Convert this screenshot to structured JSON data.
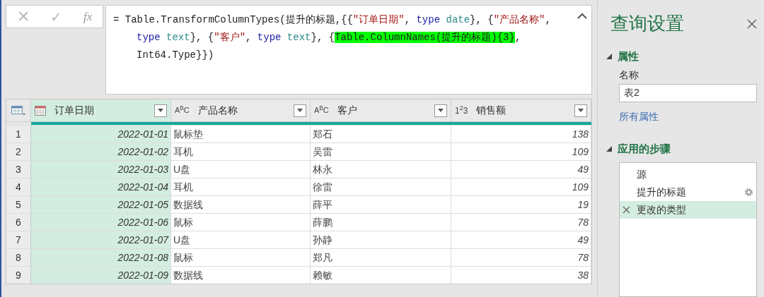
{
  "formula_bar": {
    "cancel": "✕",
    "confirm": "✓",
    "fx": "fx",
    "lines": [
      [
        {
          "kind": "plain",
          "text": "= Table.TransformColumnTypes(提升的标题,{{"
        },
        {
          "kind": "string",
          "text": "\"订单日期\""
        },
        {
          "kind": "plain",
          "text": ", "
        },
        {
          "kind": "keyword",
          "text": "type"
        },
        {
          "kind": "type",
          "text": " date"
        },
        {
          "kind": "plain",
          "text": "}, {"
        },
        {
          "kind": "string",
          "text": "\"产品名称\""
        },
        {
          "kind": "plain",
          "text": ","
        }
      ],
      [
        {
          "kind": "keyword",
          "text": "type"
        },
        {
          "kind": "type",
          "text": " text"
        },
        {
          "kind": "plain",
          "text": "}, {"
        },
        {
          "kind": "string",
          "text": "\"客户\""
        },
        {
          "kind": "plain",
          "text": ", "
        },
        {
          "kind": "keyword",
          "text": "type"
        },
        {
          "kind": "type",
          "text": " text"
        },
        {
          "kind": "plain",
          "text": "}, {"
        },
        {
          "kind": "highlight",
          "text": "Table.ColumnNames(提升的标题){3}"
        },
        {
          "kind": "plain",
          "text": ","
        }
      ],
      [
        {
          "kind": "plain",
          "text": "Int64.Type}})"
        }
      ]
    ]
  },
  "table": {
    "columns": [
      {
        "name": "订单日期",
        "kind": "date",
        "selected": true
      },
      {
        "name": "产品名称",
        "kind": "text",
        "type_icon": "A$^{B}$C",
        "selected": false
      },
      {
        "name": "客户",
        "kind": "text",
        "type_icon": "A$^{B}$C",
        "selected": false
      },
      {
        "name": "销售额",
        "kind": "number",
        "type_icon": "1$^{2}$3",
        "selected": false
      }
    ],
    "rows": [
      {
        "number": "1",
        "cells": [
          "2022-01-01",
          "鼠标垫",
          "郑石",
          "138"
        ]
      },
      {
        "number": "2",
        "cells": [
          "2022-01-02",
          "耳机",
          "吴雷",
          "109"
        ]
      },
      {
        "number": "3",
        "cells": [
          "2022-01-03",
          "U盘",
          "林永",
          "49"
        ]
      },
      {
        "number": "4",
        "cells": [
          "2022-01-04",
          "耳机",
          "徐雷",
          "109"
        ]
      },
      {
        "number": "5",
        "cells": [
          "2022-01-05",
          "数据线",
          "薛平",
          "19"
        ]
      },
      {
        "number": "6",
        "cells": [
          "2022-01-06",
          "鼠标",
          "薛鹏",
          "78"
        ]
      },
      {
        "number": "7",
        "cells": [
          "2022-01-07",
          "U盘",
          "孙静",
          "49"
        ]
      },
      {
        "number": "8",
        "cells": [
          "2022-01-08",
          "鼠标",
          "郑凡",
          "78"
        ]
      },
      {
        "number": "9",
        "cells": [
          "2022-01-09",
          "数据线",
          "赖敏",
          "38"
        ]
      }
    ]
  },
  "query_settings": {
    "title": "查询设置",
    "properties_heading": "属性",
    "name_label": "名称",
    "name_value": "表2",
    "all_properties": "所有属性",
    "steps_heading": "应用的步骤",
    "steps": [
      {
        "name": "源",
        "gear": false,
        "selected": false
      },
      {
        "name": "提升的标题",
        "gear": true,
        "selected": false
      },
      {
        "name": "更改的类型",
        "gear": false,
        "selected": true
      }
    ]
  }
}
